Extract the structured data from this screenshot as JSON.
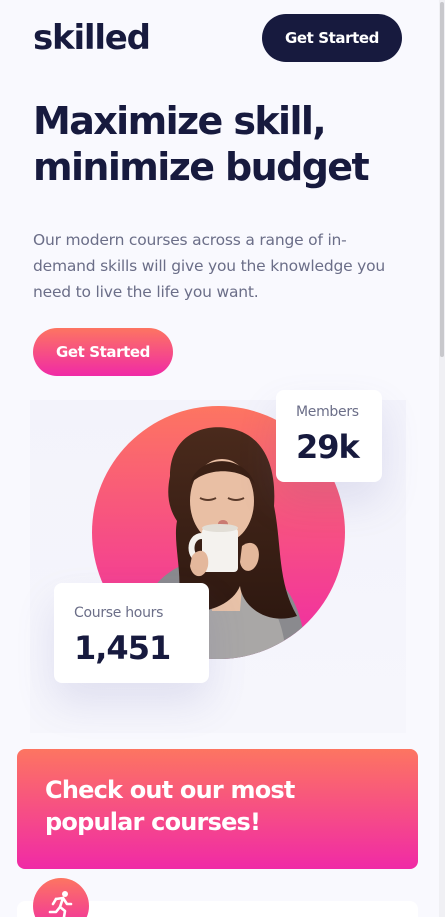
{
  "header": {
    "logo": "skilled",
    "cta_label": "Get Started"
  },
  "hero": {
    "title": "Maximize skill, minimize budget",
    "description": "Our modern courses across a range of in-demand skills will give you the knowledge you need to live the life you want.",
    "cta_label": "Get Started"
  },
  "stats": {
    "members": {
      "label": "Members",
      "value": "29k"
    },
    "course_hours": {
      "label": "Course hours",
      "value": "1,451"
    }
  },
  "promo": {
    "title": "Check out our most popular courses!"
  },
  "course_icon": "running-person-icon",
  "colors": {
    "navy": "#171a3e",
    "gradient_start": "#fd7561",
    "gradient_end": "#f02aa6",
    "body_text": "#6b6e88",
    "background": "#f9f9fe"
  }
}
